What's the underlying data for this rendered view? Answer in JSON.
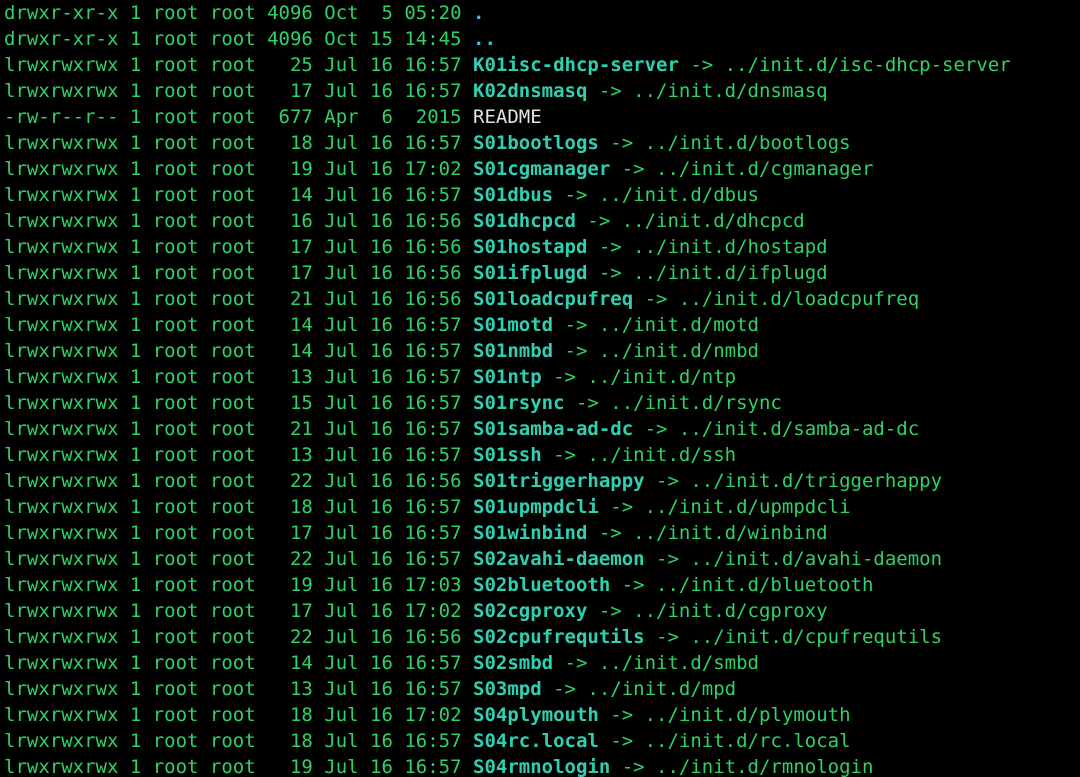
{
  "colors": {
    "bg": "#000000",
    "green": "#2fd267",
    "blue": "#32c7e6",
    "cyan": "#31cfb1",
    "white": "#e4e4e4"
  },
  "listing": [
    {
      "perm": "drwxr-xr-x",
      "n": "1",
      "u": "root",
      "g": "root",
      "sz": "4096",
      "date": "Oct  5 05:20",
      "name": ".",
      "type": "dir",
      "link": ""
    },
    {
      "perm": "drwxr-xr-x",
      "n": "1",
      "u": "root",
      "g": "root",
      "sz": "4096",
      "date": "Oct 15 14:45",
      "name": "..",
      "type": "dir",
      "link": ""
    },
    {
      "perm": "lrwxrwxrwx",
      "n": "1",
      "u": "root",
      "g": "root",
      "sz": "25",
      "date": "Jul 16 16:57",
      "name": "K01isc-dhcp-server",
      "type": "link",
      "link": "../init.d/isc-dhcp-server"
    },
    {
      "perm": "lrwxrwxrwx",
      "n": "1",
      "u": "root",
      "g": "root",
      "sz": "17",
      "date": "Jul 16 16:57",
      "name": "K02dnsmasq",
      "type": "link",
      "link": "../init.d/dnsmasq"
    },
    {
      "perm": "-rw-r--r--",
      "n": "1",
      "u": "root",
      "g": "root",
      "sz": "677",
      "date": "Apr  6  2015",
      "name": "README",
      "type": "file",
      "link": ""
    },
    {
      "perm": "lrwxrwxrwx",
      "n": "1",
      "u": "root",
      "g": "root",
      "sz": "18",
      "date": "Jul 16 16:57",
      "name": "S01bootlogs",
      "type": "link",
      "link": "../init.d/bootlogs"
    },
    {
      "perm": "lrwxrwxrwx",
      "n": "1",
      "u": "root",
      "g": "root",
      "sz": "19",
      "date": "Jul 16 17:02",
      "name": "S01cgmanager",
      "type": "link",
      "link": "../init.d/cgmanager"
    },
    {
      "perm": "lrwxrwxrwx",
      "n": "1",
      "u": "root",
      "g": "root",
      "sz": "14",
      "date": "Jul 16 16:57",
      "name": "S01dbus",
      "type": "link",
      "link": "../init.d/dbus"
    },
    {
      "perm": "lrwxrwxrwx",
      "n": "1",
      "u": "root",
      "g": "root",
      "sz": "16",
      "date": "Jul 16 16:56",
      "name": "S01dhcpcd",
      "type": "link",
      "link": "../init.d/dhcpcd"
    },
    {
      "perm": "lrwxrwxrwx",
      "n": "1",
      "u": "root",
      "g": "root",
      "sz": "17",
      "date": "Jul 16 16:56",
      "name": "S01hostapd",
      "type": "link",
      "link": "../init.d/hostapd"
    },
    {
      "perm": "lrwxrwxrwx",
      "n": "1",
      "u": "root",
      "g": "root",
      "sz": "17",
      "date": "Jul 16 16:56",
      "name": "S01ifplugd",
      "type": "link",
      "link": "../init.d/ifplugd"
    },
    {
      "perm": "lrwxrwxrwx",
      "n": "1",
      "u": "root",
      "g": "root",
      "sz": "21",
      "date": "Jul 16 16:56",
      "name": "S01loadcpufreq",
      "type": "link",
      "link": "../init.d/loadcpufreq"
    },
    {
      "perm": "lrwxrwxrwx",
      "n": "1",
      "u": "root",
      "g": "root",
      "sz": "14",
      "date": "Jul 16 16:57",
      "name": "S01motd",
      "type": "link",
      "link": "../init.d/motd"
    },
    {
      "perm": "lrwxrwxrwx",
      "n": "1",
      "u": "root",
      "g": "root",
      "sz": "14",
      "date": "Jul 16 16:57",
      "name": "S01nmbd",
      "type": "link",
      "link": "../init.d/nmbd"
    },
    {
      "perm": "lrwxrwxrwx",
      "n": "1",
      "u": "root",
      "g": "root",
      "sz": "13",
      "date": "Jul 16 16:57",
      "name": "S01ntp",
      "type": "link",
      "link": "../init.d/ntp"
    },
    {
      "perm": "lrwxrwxrwx",
      "n": "1",
      "u": "root",
      "g": "root",
      "sz": "15",
      "date": "Jul 16 16:57",
      "name": "S01rsync",
      "type": "link",
      "link": "../init.d/rsync"
    },
    {
      "perm": "lrwxrwxrwx",
      "n": "1",
      "u": "root",
      "g": "root",
      "sz": "21",
      "date": "Jul 16 16:57",
      "name": "S01samba-ad-dc",
      "type": "link",
      "link": "../init.d/samba-ad-dc"
    },
    {
      "perm": "lrwxrwxrwx",
      "n": "1",
      "u": "root",
      "g": "root",
      "sz": "13",
      "date": "Jul 16 16:57",
      "name": "S01ssh",
      "type": "link",
      "link": "../init.d/ssh"
    },
    {
      "perm": "lrwxrwxrwx",
      "n": "1",
      "u": "root",
      "g": "root",
      "sz": "22",
      "date": "Jul 16 16:56",
      "name": "S01triggerhappy",
      "type": "link",
      "link": "../init.d/triggerhappy"
    },
    {
      "perm": "lrwxrwxrwx",
      "n": "1",
      "u": "root",
      "g": "root",
      "sz": "18",
      "date": "Jul 16 16:57",
      "name": "S01upmpdcli",
      "type": "link",
      "link": "../init.d/upmpdcli"
    },
    {
      "perm": "lrwxrwxrwx",
      "n": "1",
      "u": "root",
      "g": "root",
      "sz": "17",
      "date": "Jul 16 16:57",
      "name": "S01winbind",
      "type": "link",
      "link": "../init.d/winbind"
    },
    {
      "perm": "lrwxrwxrwx",
      "n": "1",
      "u": "root",
      "g": "root",
      "sz": "22",
      "date": "Jul 16 16:57",
      "name": "S02avahi-daemon",
      "type": "link",
      "link": "../init.d/avahi-daemon"
    },
    {
      "perm": "lrwxrwxrwx",
      "n": "1",
      "u": "root",
      "g": "root",
      "sz": "19",
      "date": "Jul 16 17:03",
      "name": "S02bluetooth",
      "type": "link",
      "link": "../init.d/bluetooth"
    },
    {
      "perm": "lrwxrwxrwx",
      "n": "1",
      "u": "root",
      "g": "root",
      "sz": "17",
      "date": "Jul 16 17:02",
      "name": "S02cgproxy",
      "type": "link",
      "link": "../init.d/cgproxy"
    },
    {
      "perm": "lrwxrwxrwx",
      "n": "1",
      "u": "root",
      "g": "root",
      "sz": "22",
      "date": "Jul 16 16:56",
      "name": "S02cpufrequtils",
      "type": "link",
      "link": "../init.d/cpufrequtils"
    },
    {
      "perm": "lrwxrwxrwx",
      "n": "1",
      "u": "root",
      "g": "root",
      "sz": "14",
      "date": "Jul 16 16:57",
      "name": "S02smbd",
      "type": "link",
      "link": "../init.d/smbd"
    },
    {
      "perm": "lrwxrwxrwx",
      "n": "1",
      "u": "root",
      "g": "root",
      "sz": "13",
      "date": "Jul 16 16:57",
      "name": "S03mpd",
      "type": "link",
      "link": "../init.d/mpd"
    },
    {
      "perm": "lrwxrwxrwx",
      "n": "1",
      "u": "root",
      "g": "root",
      "sz": "18",
      "date": "Jul 16 17:02",
      "name": "S04plymouth",
      "type": "link",
      "link": "../init.d/plymouth"
    },
    {
      "perm": "lrwxrwxrwx",
      "n": "1",
      "u": "root",
      "g": "root",
      "sz": "18",
      "date": "Jul 16 16:57",
      "name": "S04rc.local",
      "type": "link",
      "link": "../init.d/rc.local"
    },
    {
      "perm": "lrwxrwxrwx",
      "n": "1",
      "u": "root",
      "g": "root",
      "sz": "19",
      "date": "Jul 16 16:57",
      "name": "S04rmnologin",
      "type": "link",
      "link": "../init.d/rmnologin"
    }
  ]
}
